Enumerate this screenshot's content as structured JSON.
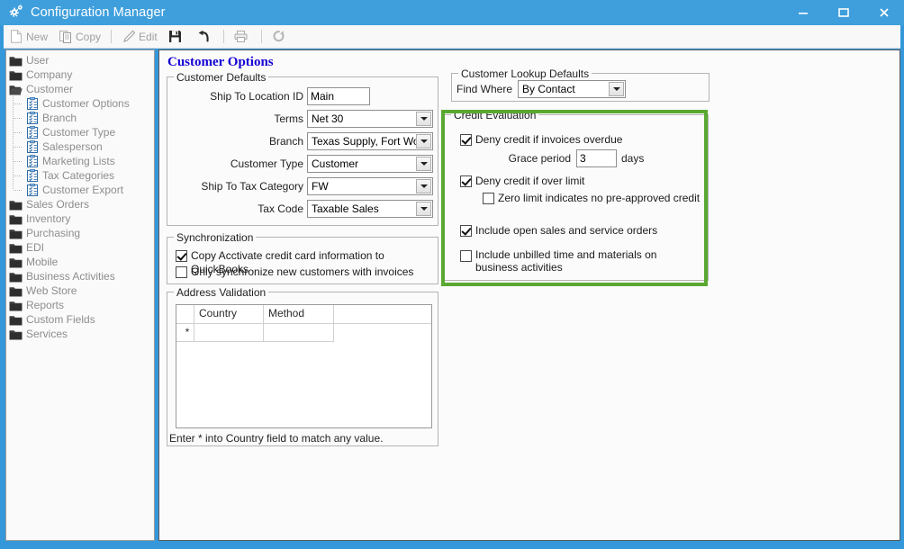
{
  "window": {
    "title": "Configuration Manager",
    "icon": "gears-icon",
    "minimize_label": "Minimize",
    "maximize_label": "Maximize",
    "close_label": "Close",
    "accent_color": "#3f9fdc",
    "highlight_color": "#5aa832"
  },
  "toolbar": {
    "items": [
      {
        "label": "New",
        "icon": "new-document-icon",
        "enabled": false
      },
      {
        "label": "Copy",
        "icon": "copy-icon",
        "enabled": false
      },
      {
        "label": "Edit",
        "icon": "pencil-icon",
        "enabled": false
      },
      {
        "label": "",
        "icon": "save-icon",
        "enabled": true
      },
      {
        "label": "",
        "icon": "undo-icon",
        "enabled": true
      },
      {
        "label": "",
        "icon": "print-icon",
        "enabled": false
      },
      {
        "label": "",
        "icon": "refresh-icon",
        "enabled": false
      }
    ]
  },
  "sidebar": {
    "items": [
      {
        "label": "User",
        "icon": "folder-icon",
        "level": 0,
        "expanded": false
      },
      {
        "label": "Company",
        "icon": "folder-icon",
        "level": 0,
        "expanded": false
      },
      {
        "label": "Customer",
        "icon": "folder-open-icon",
        "level": 0,
        "expanded": true
      },
      {
        "label": "Customer Options",
        "icon": "clipboard-icon",
        "level": 1,
        "selected": true
      },
      {
        "label": "Branch",
        "icon": "clipboard-icon",
        "level": 1
      },
      {
        "label": "Customer Type",
        "icon": "clipboard-icon",
        "level": 1
      },
      {
        "label": "Salesperson",
        "icon": "clipboard-icon",
        "level": 1
      },
      {
        "label": "Marketing Lists",
        "icon": "clipboard-icon",
        "level": 1
      },
      {
        "label": "Tax Categories",
        "icon": "clipboard-icon",
        "level": 1
      },
      {
        "label": "Customer Export",
        "icon": "clipboard-icon",
        "level": 1,
        "last": true
      },
      {
        "label": "Sales Orders",
        "icon": "folder-icon",
        "level": 0
      },
      {
        "label": "Inventory",
        "icon": "folder-icon",
        "level": 0
      },
      {
        "label": "Purchasing",
        "icon": "folder-icon",
        "level": 0
      },
      {
        "label": "EDI",
        "icon": "folder-icon",
        "level": 0
      },
      {
        "label": "Mobile",
        "icon": "folder-icon",
        "level": 0
      },
      {
        "label": "Business Activities",
        "icon": "folder-icon",
        "level": 0
      },
      {
        "label": "Web Store",
        "icon": "folder-icon",
        "level": 0
      },
      {
        "label": "Reports",
        "icon": "folder-icon",
        "level": 0
      },
      {
        "label": "Custom Fields",
        "icon": "folder-icon",
        "level": 0
      },
      {
        "label": "Services",
        "icon": "folder-icon",
        "level": 0
      }
    ]
  },
  "page": {
    "title": "Customer Options",
    "customer_defaults": {
      "title": "Customer Defaults",
      "fields": [
        {
          "label": "Ship To Location ID",
          "type": "text",
          "value": "Main"
        },
        {
          "label": "Terms",
          "type": "combo",
          "value": "Net 30"
        },
        {
          "label": "Branch",
          "type": "combo",
          "value": "Texas Supply, Fort Worth"
        },
        {
          "label": "Customer Type",
          "type": "combo",
          "value": "Customer"
        },
        {
          "label": "Ship To Tax Category",
          "type": "combo",
          "value": "FW"
        },
        {
          "label": "Tax Code",
          "type": "combo",
          "value": "Taxable Sales"
        }
      ]
    },
    "synchronization": {
      "title": "Synchronization",
      "checkboxes": [
        {
          "label": "Copy Acctivate credit card information to QuickBooks",
          "checked": true
        },
        {
          "label": "Only synchronize new customers with invoices",
          "checked": false
        }
      ]
    },
    "address_validation": {
      "title": "Address Validation",
      "columns": [
        "",
        "Country",
        "Method",
        ""
      ],
      "rows": [
        {
          "marker": "*",
          "country": "",
          "method": "",
          "rest": ""
        }
      ],
      "note": "Enter * into Country field to match any value."
    },
    "customer_lookup_defaults": {
      "title": "Customer Lookup Defaults",
      "find_where_label": "Find Where",
      "find_where_value": "By Contact"
    },
    "credit_evaluation": {
      "title": "Credit Evaluation",
      "deny_overdue": {
        "label": "Deny credit if invoices overdue",
        "checked": true
      },
      "grace_period_label": "Grace period",
      "grace_period_value": "3",
      "grace_period_units": "days",
      "deny_over_limit": {
        "label": "Deny credit if over limit",
        "checked": true
      },
      "zero_limit": {
        "label": "Zero limit indicates no pre-approved credit",
        "checked": false
      },
      "include_open_orders": {
        "label": "Include open sales and service orders",
        "checked": true
      },
      "include_unbilled": {
        "label": "Include unbilled time and materials on business activities",
        "checked": false
      }
    }
  }
}
